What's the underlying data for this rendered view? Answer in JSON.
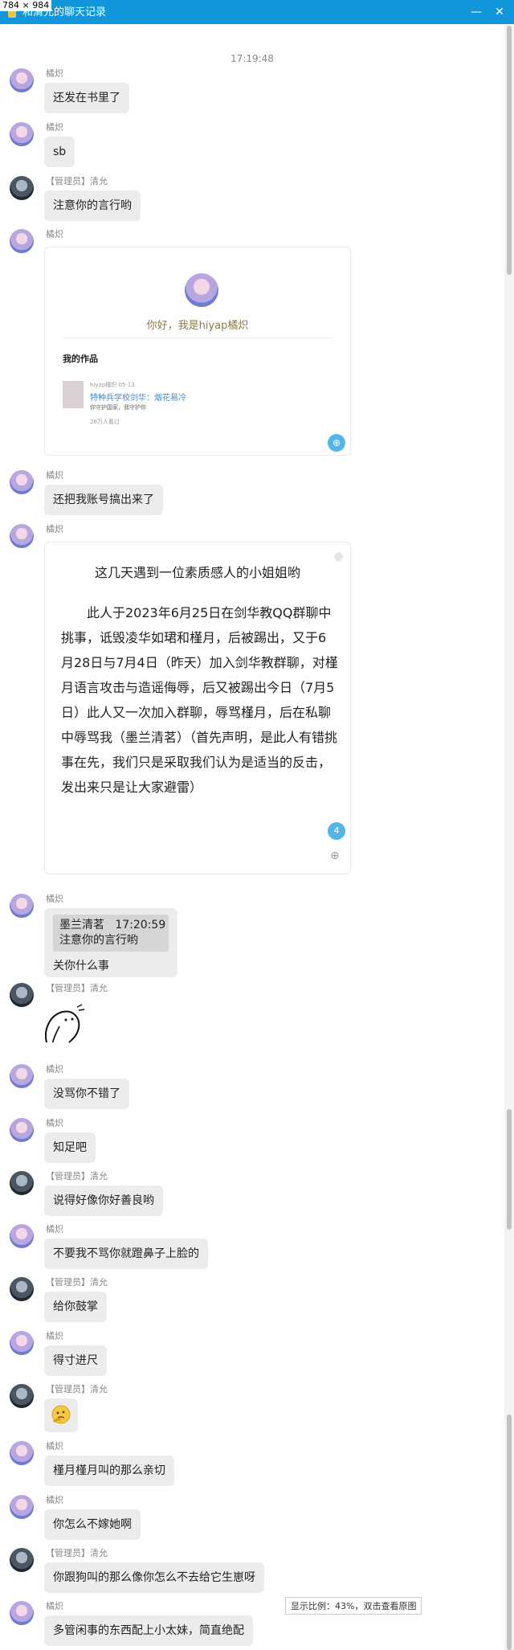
{
  "window": {
    "dimension_label": "784 × 984",
    "title": "和清允的聊天记录",
    "minimize": "—",
    "close": "✕"
  },
  "timestamp": "17:19:48",
  "names": {
    "jz": "橘炽",
    "qy_role": "【管理员】",
    "qy": "清允"
  },
  "messages": {
    "m1": "还发在书里了",
    "m2": "sb",
    "m3": "注意你的言行哟",
    "m5": "还把我账号搞出来了",
    "m7_text": "关你什么事",
    "m9": "没骂你不错了",
    "m10": "知足吧",
    "m11": "说得好像你好善良哟",
    "m12": "不要我不骂你就蹬鼻子上脸的",
    "m13": "给你鼓掌",
    "m14": "得寸进尺",
    "m16": "槿月槿月叫的那么亲切",
    "m17": "你怎么不嫁她啊",
    "m18": "你跟狗叫的那么像你怎么不去给它生崽呀",
    "m19": "多管闲事的东西配上小太妹，简直绝配"
  },
  "quote": {
    "author": "墨兰清茗",
    "time": "17:20:59",
    "text": "注意你的言行哟"
  },
  "profile_card": {
    "greeting": "你好，我是hiyap橘炽",
    "works_title": "我的作品",
    "item_meta": "hiyap橘炽 05-13",
    "item_title": "特种兵学校剑华：烟花易冷",
    "item_desc": "你守护国家，我守护你",
    "item_reads": "26万人看过"
  },
  "article_card": {
    "title": "这几天遇到一位素质感人的小姐姐哟",
    "body": "此人于2023年6月25日在剑华教QQ群聊中挑事，诋毁凌华如珺和槿月，后被踢出，又于6月28日与7月4日（昨天）加入剑华教群聊，对槿月语言攻击与造谣侮辱，后又被踢出今日（7月5日）此人又一次加入群聊，辱骂槿月，后在私聊中辱骂我（墨兰清茗）（首先声明，是此人有错挑事在先，我们只是采取我们认为是适当的反击，发出来只是让大家避雷）",
    "badge": "4"
  },
  "zoom_tip": "显示比例：43%，双击查看原图"
}
